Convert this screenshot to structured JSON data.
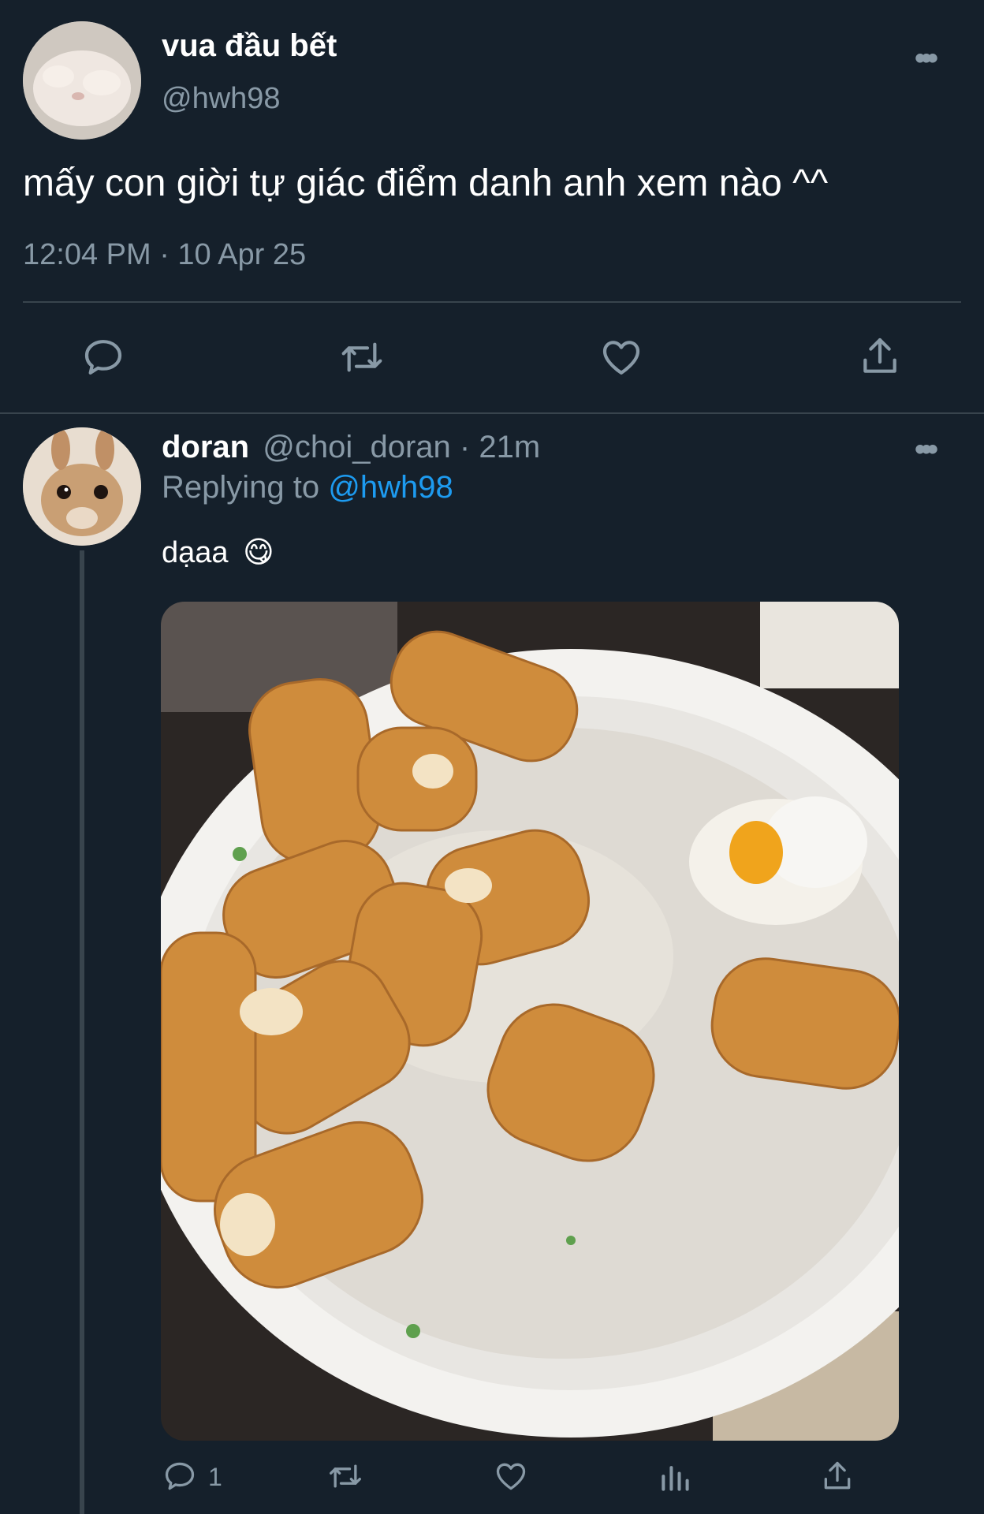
{
  "main_tweet": {
    "display_name": "vua đầu bết",
    "handle": "@hwh98",
    "text": "mấy con giời tự giác điểm danh anh xem nào ^^",
    "timestamp": "12:04 PM · 10 Apr 25",
    "more_label": "•••"
  },
  "reply": {
    "display_name": "doran",
    "handle_time": "@choi_doran · 21m",
    "replying_prefix": "Replying to ",
    "replying_handle": "@hwh98",
    "text": "dạaa",
    "emoji": "😋",
    "more_label": "•••",
    "reply_count": "1"
  },
  "colors": {
    "background": "#15202b",
    "muted": "#8899a6",
    "link": "#1d9bf0",
    "divider": "#38444d"
  }
}
